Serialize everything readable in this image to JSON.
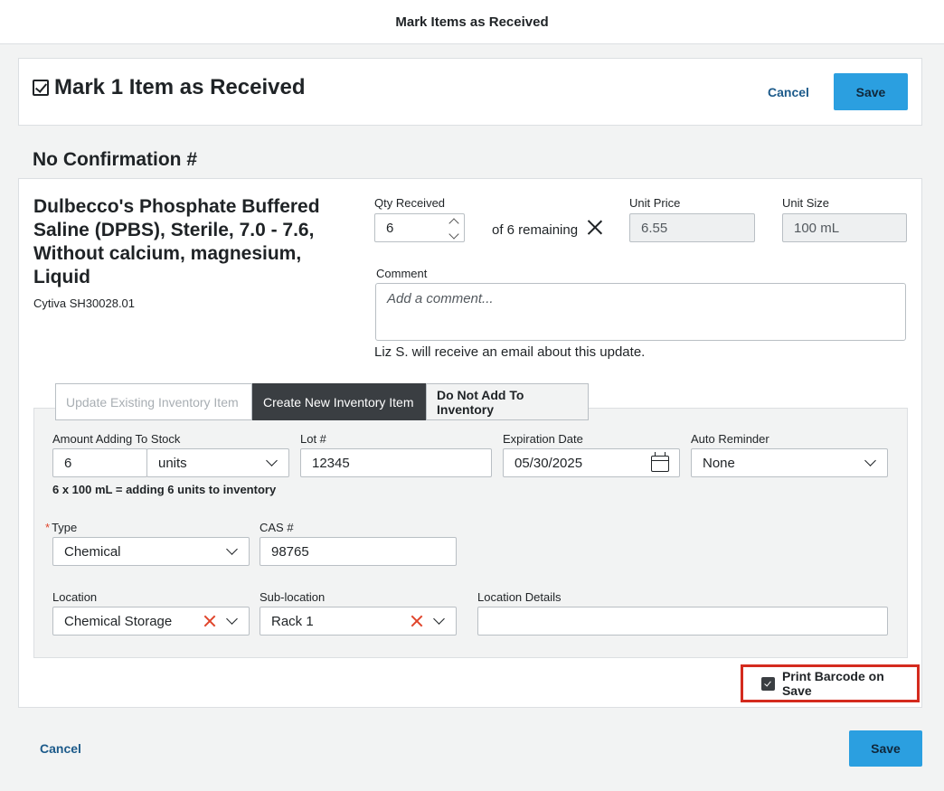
{
  "window": {
    "title": "Mark Items as Received"
  },
  "header": {
    "title": "Mark 1 Item as Received",
    "cancel_label": "Cancel",
    "save_label": "Save"
  },
  "section": {
    "title": "No Confirmation #"
  },
  "item": {
    "name": "Dulbecco's Phosphate Buffered Saline (DPBS), Sterile, 7.0 - 7.6, Without calcium, magnesium, Liquid",
    "sku": "Cytiva SH30028.01",
    "qty_label": "Qty Received",
    "qty_value": "6",
    "remaining_text": "of 6 remaining",
    "unit_price_label": "Unit Price",
    "unit_price_value": "6.55",
    "unit_size_label": "Unit Size",
    "unit_size_value": "100 mL",
    "comment_label": "Comment",
    "comment_placeholder": "Add a comment...",
    "comment_note": "Liz S. will receive an email about this update."
  },
  "tabs": [
    {
      "label": "Update Existing Inventory Item",
      "state": "disabled"
    },
    {
      "label": "Create New Inventory Item",
      "state": "active"
    },
    {
      "label": "Do Not Add To Inventory",
      "state": "inactive"
    }
  ],
  "inventory": {
    "amount_label": "Amount Adding To Stock",
    "amount_value": "6",
    "unit_value": "units",
    "amount_note": "6 x 100 mL = adding 6 units to inventory",
    "lot_label": "Lot #",
    "lot_value": "12345",
    "expiration_label": "Expiration Date",
    "expiration_value": "05/30/2025",
    "reminder_label": "Auto Reminder",
    "reminder_value": "None",
    "type_required": "*",
    "type_label": "Type",
    "type_value": "Chemical",
    "cas_label": "CAS #",
    "cas_value": "98765",
    "location_label": "Location",
    "location_value": "Chemical Storage",
    "sublocation_label": "Sub-location",
    "sublocation_value": "Rack 1",
    "location_details_label": "Location Details",
    "location_details_value": ""
  },
  "barcode": {
    "label": "Print Barcode on Save",
    "checked": true
  },
  "footer": {
    "cancel_label": "Cancel",
    "save_label": "Save"
  },
  "colors": {
    "primary": "#2b9fe0",
    "link": "#1c5a8a",
    "highlight": "#d42b1e",
    "clear_icon": "#e0452b",
    "active_tab": "#3a3e42"
  }
}
